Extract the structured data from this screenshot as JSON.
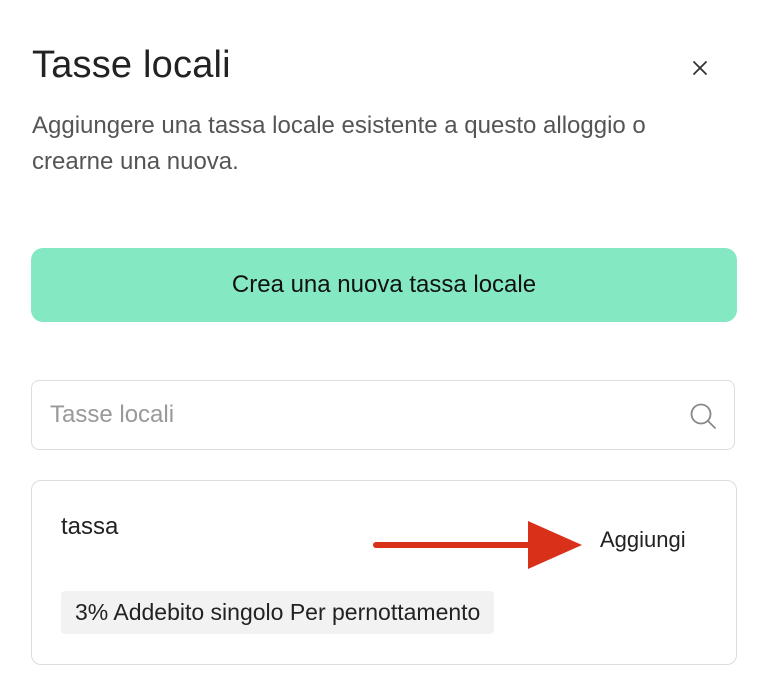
{
  "dialog": {
    "title": "Tasse locali",
    "subtitle": "Aggiungere una tassa locale esistente a questo alloggio o crearne una nuova.",
    "close_icon": "close-icon"
  },
  "create_button": {
    "label": "Crea una nuova tassa locale",
    "color": "#84e9c3"
  },
  "search": {
    "placeholder": "Tasse locali",
    "value": "",
    "icon": "search-icon"
  },
  "results": [
    {
      "name": "tassa",
      "action_label": "Aggiungi",
      "tag": "3% Addebito singolo Per pernottamento"
    }
  ],
  "annotation": {
    "type": "arrow",
    "color": "#d9301a"
  }
}
